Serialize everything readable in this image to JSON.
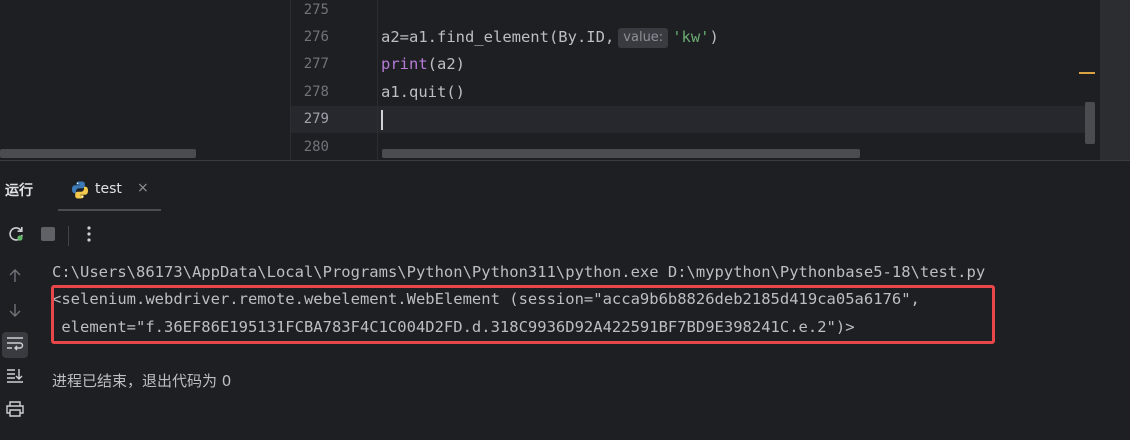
{
  "editor": {
    "lines": [
      {
        "number": "275",
        "code": ""
      },
      {
        "number": "276",
        "code_before": "a2=a1.find_element(By.ID,",
        "hint": "value:",
        "string": "'kw'",
        "code_after": ")"
      },
      {
        "number": "277",
        "keyword": "print",
        "code_after": "(a2)"
      },
      {
        "number": "278",
        "code": "a1.quit()"
      },
      {
        "number": "279",
        "code": ""
      },
      {
        "number": "280",
        "code": ""
      }
    ]
  },
  "tool_window": {
    "title": "运行",
    "tab": {
      "label": "test",
      "icon": "python-icon",
      "close": "×"
    }
  },
  "toolbar": {
    "rerun_icon": "rerun-icon",
    "stop_icon": "stop-icon",
    "more_icon": "more-vertical-icon"
  },
  "sidebar": {
    "icons": [
      "arrow-up-icon",
      "arrow-down-icon",
      "soft-wrap-icon",
      "scroll-to-end-icon",
      "print-icon"
    ]
  },
  "console": {
    "line1": "C:\\Users\\86173\\AppData\\Local\\Programs\\Python\\Python311\\python.exe D:\\mypython\\Pythonbase5-18\\test.py",
    "line2": "<selenium.webdriver.remote.webelement.WebElement (session=\"acca9b6b8826deb2185d419ca05a6176\",",
    "line3": " element=\"f.36EF86E195131FCBA783F4C1C004D2FD.d.318C9936D92A422591BF7BD9E398241C.e.2\")>",
    "line4": "进程已结束，退出代码为 0"
  },
  "colors": {
    "highlight_box": "#e8474a",
    "keyword": "#b57bd6",
    "string": "#6aab73"
  }
}
